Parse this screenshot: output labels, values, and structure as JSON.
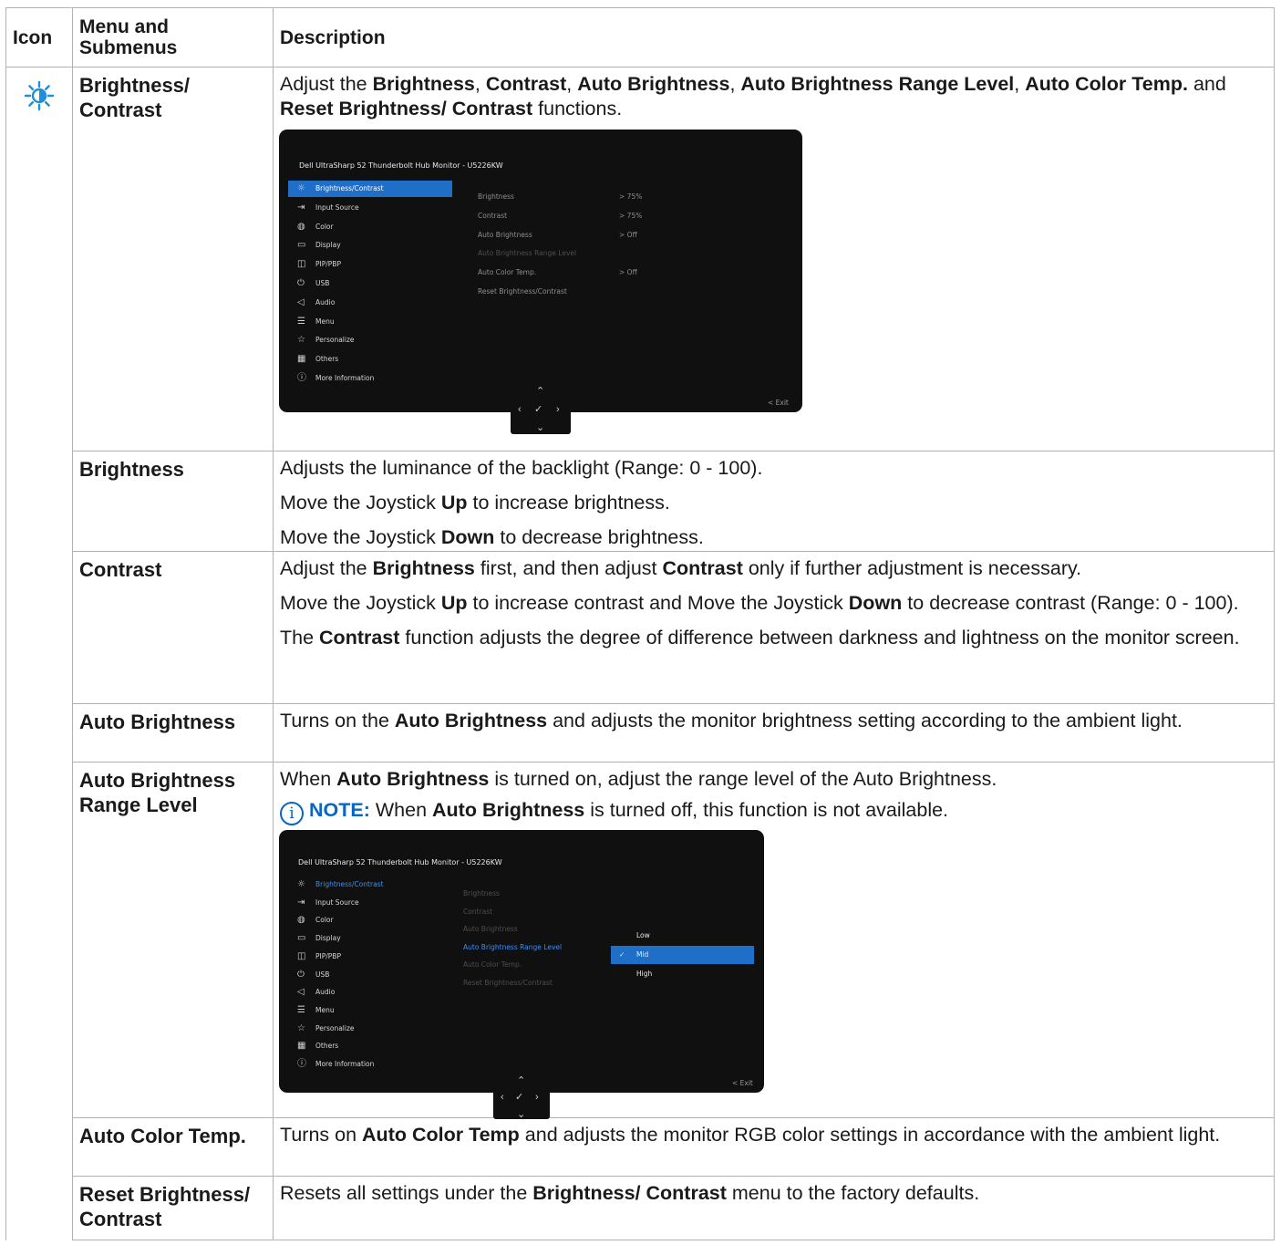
{
  "header": {
    "icon": "Icon",
    "menu": "Menu and Submenus",
    "description": "Description"
  },
  "icon_name": "brightness-sun-icon",
  "accent_color": "#0b66c3",
  "rows": [
    {
      "menu": "Brightness/ Contrast",
      "desc_parts": [
        "Adjust the ",
        "Brightness",
        ", ",
        "Contrast",
        ", ",
        "Auto Brightness",
        ", ",
        "Auto Brightness Range Level",
        ", ",
        "Auto Color Temp.",
        " and ",
        "Reset Brightness/ Contrast",
        " functions."
      ]
    },
    {
      "menu": "Brightness",
      "p1": "Adjusts the luminance of the backlight (Range: 0 - 100).",
      "p2": [
        "Move the Joystick ",
        "Up",
        " to increase brightness."
      ],
      "p3": [
        "Move the Joystick ",
        "Down",
        " to decrease brightness."
      ]
    },
    {
      "menu": "Contrast",
      "p1": [
        "Adjust the ",
        "Brightness",
        " first, and then adjust ",
        "Contrast",
        " only if further adjustment is necessary."
      ],
      "p2": [
        "Move the Joystick ",
        "Up",
        " to increase contrast and Move the Joystick ",
        "Down",
        " to decrease contrast (Range: 0 - 100)."
      ],
      "p3": [
        "The ",
        "Contrast",
        " function adjusts the degree of difference between darkness and lightness on the monitor screen."
      ]
    },
    {
      "menu": "Auto Brightness",
      "p1": [
        "Turns on the ",
        "Auto Brightness",
        " and adjusts the monitor brightness setting according to the ambient light."
      ]
    },
    {
      "menu": "Auto Brightness Range Level",
      "p1": [
        "When ",
        "Auto Brightness",
        " is turned on, adjust the range level of the Auto Brightness."
      ],
      "note_label": "NOTE:",
      "note": [
        "When ",
        "Auto Brightness",
        " is turned off, this function is not available."
      ]
    },
    {
      "menu": "Auto Color Temp.",
      "p1": [
        "Turns on ",
        "Auto Color Temp",
        " and adjusts the monitor RGB color settings in accordance with the ambient light."
      ]
    },
    {
      "menu": "Reset Brightness/ Contrast",
      "p1": [
        "Resets all settings under the ",
        "Brightness/ Contrast",
        " menu to the factory defaults."
      ]
    }
  ],
  "osd": {
    "title": "Dell UltraSharp 52 Thunderbolt Hub Monitor - U5226KW",
    "menu": [
      "Brightness/Contrast",
      "Input Source",
      "Color",
      "Display",
      "PIP/PBP",
      "USB",
      "Audio",
      "Menu",
      "Personalize",
      "Others",
      "More Information"
    ],
    "submenu": [
      "Brightness",
      "Contrast",
      "Auto Brightness",
      "Auto Brightness Range Level",
      "Auto Color Temp.",
      "Reset Brightness/Contrast"
    ],
    "values": [
      "> 75%",
      "> 75%",
      "> Off",
      "",
      "> Off",
      ""
    ],
    "range_options": [
      "Low",
      "Mid",
      "High"
    ],
    "range_selected": "Mid",
    "exit": "< Exit"
  }
}
